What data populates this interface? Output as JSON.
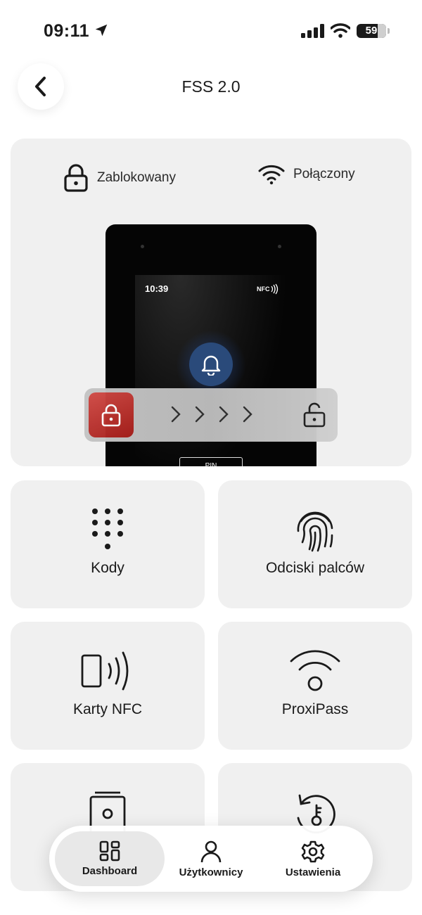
{
  "status_bar": {
    "time": "09:11",
    "battery": "59"
  },
  "header": {
    "title": "FSS 2.0"
  },
  "status": {
    "lock_state": "Zablokowany",
    "connection_state": "Połączony"
  },
  "device": {
    "screen_time": "10:39",
    "nfc_label": "NFC",
    "pin_label": "PIN"
  },
  "tiles": [
    {
      "label": "Kody"
    },
    {
      "label": "Odciski palców"
    },
    {
      "label": "Karty NFC"
    },
    {
      "label": "ProxiPass"
    },
    {
      "label": ""
    },
    {
      "label": ""
    }
  ],
  "nav": {
    "dashboard": "Dashboard",
    "users": "Użytkownicy",
    "settings": "Ustawienia"
  },
  "colors": {
    "accent_red": "#b8302b",
    "card_bg": "#f0f0f0",
    "bell_blue": "#2a4a7a"
  },
  "icons": {
    "back": "chevron-left-icon",
    "lock": "lock-icon",
    "wifi": "wifi-icon",
    "keypad": "keypad-icon",
    "fingerprint": "fingerprint-icon",
    "nfc": "nfc-card-icon",
    "proxipass": "proxipass-icon",
    "intercom": "intercom-icon",
    "history": "history-key-icon",
    "dashboard": "dashboard-grid-icon",
    "users": "user-icon",
    "settings": "gear-icon"
  }
}
